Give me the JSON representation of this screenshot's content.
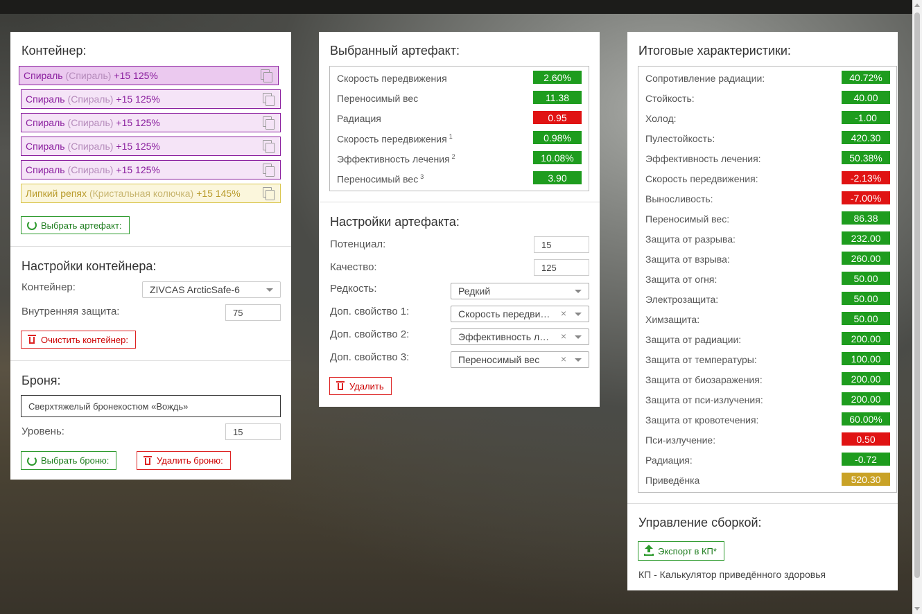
{
  "colors": {
    "green": "#1e9c1e",
    "red": "#e01313",
    "gold": "#c9a227",
    "purple": "#8a1e9e"
  },
  "container": {
    "title": "Контейнер:",
    "slots": [
      {
        "name": "Спираль",
        "alt": "(Спираль)",
        "stats": "+15 125%",
        "icon": "copy-icon"
      },
      {
        "name": "Спираль",
        "alt": "(Спираль)",
        "stats": "+15 125%",
        "icon": "copy-icon"
      },
      {
        "name": "Спираль",
        "alt": "(Спираль)",
        "stats": "+15 125%",
        "icon": "copy-icon"
      },
      {
        "name": "Спираль",
        "alt": "(Спираль)",
        "stats": "+15 125%",
        "icon": "copy-icon"
      },
      {
        "name": "Спираль",
        "alt": "(Спираль)",
        "stats": "+15 125%",
        "icon": "copy-icon"
      },
      {
        "name": "Липкий репях",
        "alt": "(Кристальная колючка)",
        "stats": "+15 145%",
        "icon": "copy-icon"
      }
    ],
    "choose_button": "Выбрать артефакт:"
  },
  "container_settings": {
    "title": "Настройки контейнера:",
    "container_label": "Контейнер:",
    "container_value": "ZIVCAS ArcticSafe-6",
    "protection_label": "Внутренняя защита:",
    "protection_value": "75",
    "clear_button": "Очистить контейнер:"
  },
  "armor": {
    "title": "Броня:",
    "name": "Сверхтяжелый бронекостюм «Вождь»",
    "level_label": "Уровень:",
    "level_value": "15",
    "choose_button": "Выбрать броню:",
    "delete_button": "Удалить броню:"
  },
  "selected": {
    "title": "Выбранный артефакт:",
    "stats": [
      {
        "name": "Скорость передвижения",
        "sup": "",
        "value": "2.60%",
        "color": "green"
      },
      {
        "name": "Переносимый вес",
        "sup": "",
        "value": "11.38",
        "color": "green"
      },
      {
        "name": "Радиация",
        "sup": "",
        "value": "0.95",
        "color": "red"
      },
      {
        "name": "Скорость передвижения",
        "sup": "1",
        "value": "0.98%",
        "color": "green"
      },
      {
        "name": "Эффективность лечения",
        "sup": "2",
        "value": "10.08%",
        "color": "green"
      },
      {
        "name": "Переносимый вес",
        "sup": "3",
        "value": "3.90",
        "color": "green"
      }
    ]
  },
  "artifact_settings": {
    "title": "Настройки артефакта:",
    "potential_label": "Потенциал:",
    "potential_value": "15",
    "quality_label": "Качество:",
    "quality_value": "125",
    "rarity_label": "Редкость:",
    "rarity_value": "Редкий",
    "extra1_label": "Доп. свойство 1:",
    "extra1_value": "Скорость передвижения",
    "extra2_label": "Доп. свойство 2:",
    "extra2_value": "Эффективность лечения",
    "extra3_label": "Доп. свойство 3:",
    "extra3_value": "Переносимый вес",
    "clear_x": "×",
    "delete_button": "Удалить"
  },
  "totals": {
    "title": "Итоговые характеристики:",
    "stats": [
      {
        "name": "Сопротивление радиации:",
        "value": "40.72%",
        "color": "green"
      },
      {
        "name": "Стойкость:",
        "value": "40.00",
        "color": "green"
      },
      {
        "name": "Холод:",
        "value": "-1.00",
        "color": "green"
      },
      {
        "name": "Пулестойкость:",
        "value": "420.30",
        "color": "green"
      },
      {
        "name": "Эффективность лечения:",
        "value": "50.38%",
        "color": "green"
      },
      {
        "name": "Скорость передвижения:",
        "value": "-2.13%",
        "color": "red"
      },
      {
        "name": "Выносливость:",
        "value": "-7.00%",
        "color": "red"
      },
      {
        "name": "Переносимый вес:",
        "value": "86.38",
        "color": "green"
      },
      {
        "name": "Защита от разрыва:",
        "value": "232.00",
        "color": "green"
      },
      {
        "name": "Защита от взрыва:",
        "value": "260.00",
        "color": "green"
      },
      {
        "name": "Защита от огня:",
        "value": "50.00",
        "color": "green"
      },
      {
        "name": "Электрозащита:",
        "value": "50.00",
        "color": "green"
      },
      {
        "name": "Химзащита:",
        "value": "50.00",
        "color": "green"
      },
      {
        "name": "Защита от радиации:",
        "value": "200.00",
        "color": "green"
      },
      {
        "name": "Защита от температуры:",
        "value": "100.00",
        "color": "green"
      },
      {
        "name": "Защита от биозаражения:",
        "value": "200.00",
        "color": "green"
      },
      {
        "name": "Защита от пси-излучения:",
        "value": "200.00",
        "color": "green"
      },
      {
        "name": "Защита от кровотечения:",
        "value": "60.00%",
        "color": "green"
      },
      {
        "name": "Пси-излучение:",
        "value": "0.50",
        "color": "red"
      },
      {
        "name": "Радиация:",
        "value": "-0.72",
        "color": "green"
      },
      {
        "name": "Приведёнка",
        "value": "520.30",
        "color": "gold"
      }
    ]
  },
  "build": {
    "title": "Управление сборкой:",
    "export_button": "Экспорт в КП*",
    "note": "КП - Калькулятор приведённого здоровья"
  }
}
